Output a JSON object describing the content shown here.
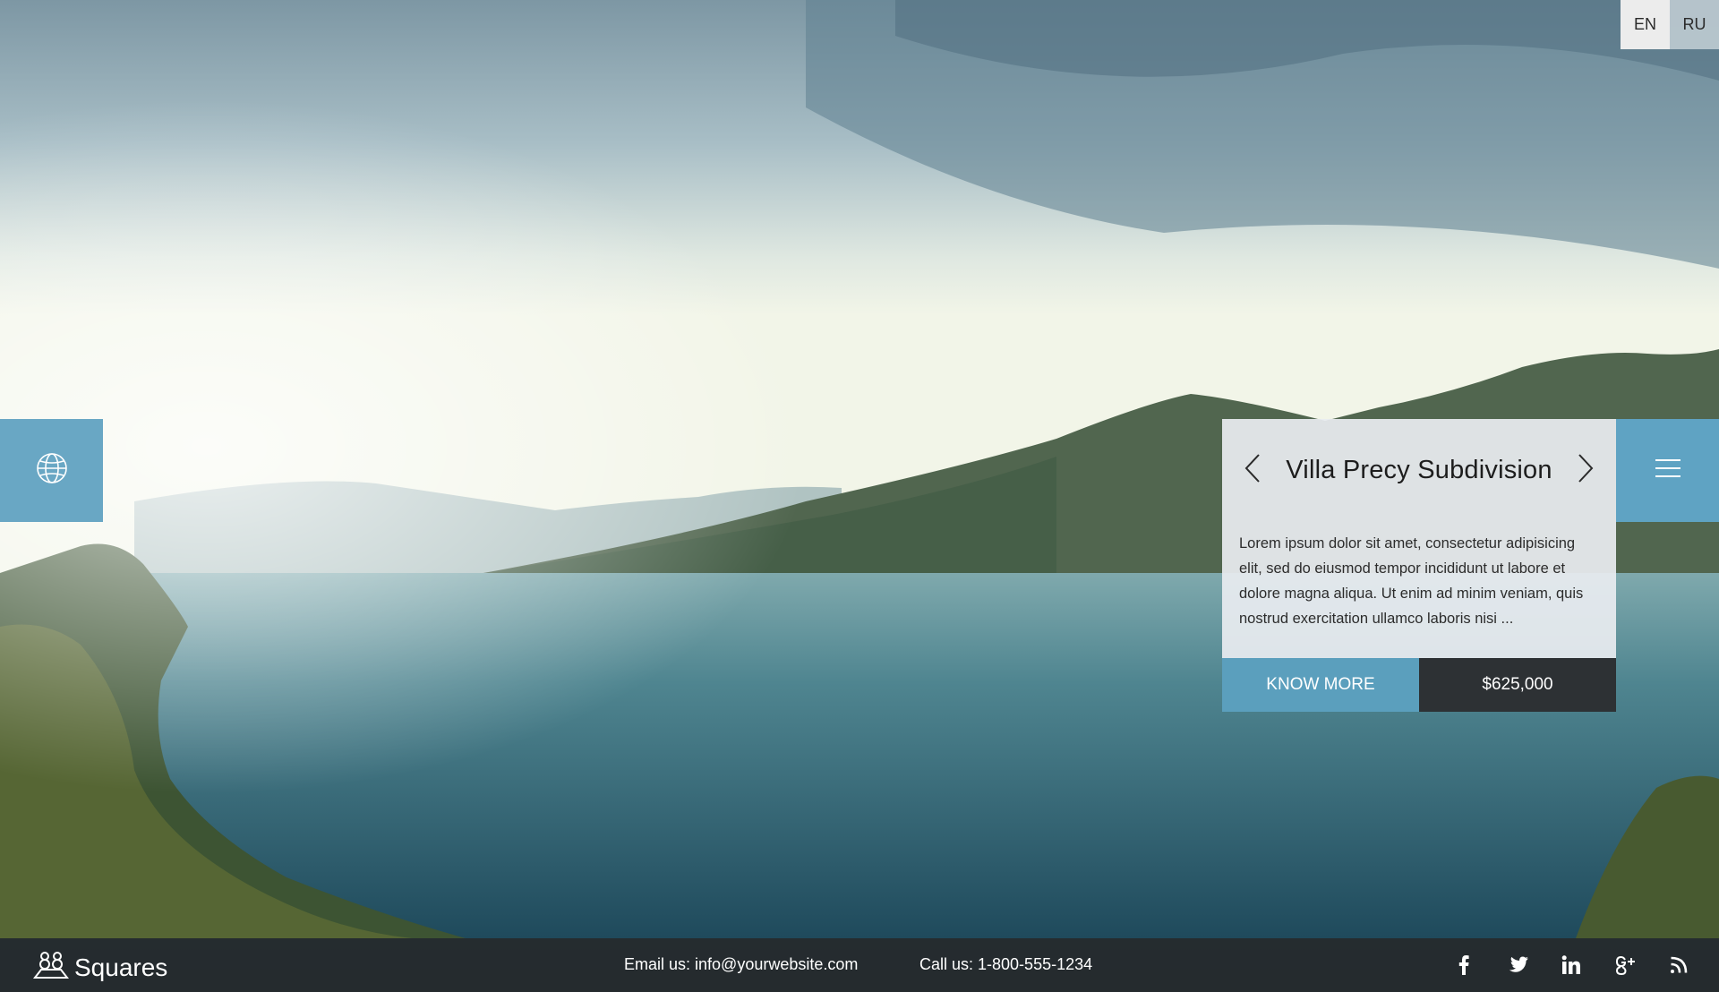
{
  "language_switcher": {
    "options": [
      "EN",
      "RU"
    ],
    "active": "EN"
  },
  "property_card": {
    "title": "Villa Precy Subdivision",
    "description": "Lorem ipsum dolor sit amet, consectetur adipisicing elit, sed do eiusmod tempor incididunt ut labore et dolore magna aliqua. Ut enim ad minim veniam, quis nostrud exercitation ullamco laboris nisi ...",
    "cta_label": "KNOW MORE",
    "price": "$625,000"
  },
  "footer": {
    "brand": "Squares",
    "email_text": "Email us: info@yourwebsite.com",
    "phone_text": "Call us: 1-800-555-1234",
    "social_icons": [
      "facebook-icon",
      "twitter-icon",
      "linkedin-icon",
      "google-plus-icon",
      "rss-icon"
    ]
  },
  "colors": {
    "accent_blue": "#69a7c4",
    "button_blue": "#5b9fbd",
    "price_dark": "#2d3134",
    "footer_bg": "#262a2c"
  }
}
